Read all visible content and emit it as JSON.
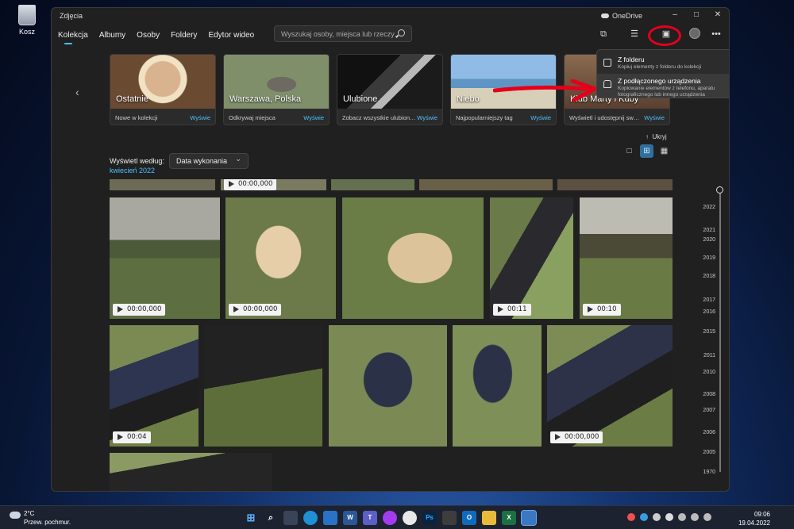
{
  "desktop": {
    "recycle_bin_label": "Kosz"
  },
  "window": {
    "title": "Zdjęcia",
    "onedrive_label": "OneDrive",
    "controls": {
      "minimize": "–",
      "maximize": "□",
      "close": "✕"
    }
  },
  "nav": {
    "tabs": [
      {
        "label": "Kolekcja",
        "active": true
      },
      {
        "label": "Albumy"
      },
      {
        "label": "Osoby"
      },
      {
        "label": "Foldery"
      },
      {
        "label": "Edytor wideo"
      }
    ],
    "search_placeholder": "Wyszukaj osoby, miejsca lub rzeczy…"
  },
  "toolbar": {
    "icons": [
      "slideshow-icon",
      "select-icon",
      "import-icon",
      "account-icon",
      "more-icon"
    ],
    "more_label": "•••"
  },
  "hero": {
    "cards": [
      {
        "title": "Ostatnie",
        "caption": "Nowe w kolekcji",
        "link": "Wyświe"
      },
      {
        "title": "Warszawa, Polska",
        "caption": "Odkrywaj miejsca",
        "link": "Wyświe"
      },
      {
        "title": "Ulubione",
        "caption": "Zobacz wszystkie ulubion…",
        "link": "Wyświe"
      },
      {
        "title": "Niebo",
        "caption": "Najpopularniejszy tag",
        "link": "Wyświe"
      },
      {
        "title": "Klub Marty i Kuby",
        "caption": "Wyświetl i udostępnij sw…",
        "link": "Wyświe"
      }
    ]
  },
  "import_menu": {
    "items": [
      {
        "title": "Z folderu",
        "desc": "Kopiuj elementy z folderu do kolekcji"
      },
      {
        "title": "Z podłączonego urządzenia",
        "desc": "Kopiowanie elementów z telefonu, aparatu fotograficznego lub innego urządzenia"
      }
    ]
  },
  "controls": {
    "view_by_label": "Wyświetl według:",
    "view_by_value": "Data wykonania",
    "hide_label": "Ukryj"
  },
  "month_label": "kwiecień 2022",
  "photos": {
    "top_strip_badge": "00:00,000",
    "row1": [
      "00:00,000",
      "00:00,000",
      "",
      "00:11",
      "00:10"
    ],
    "row2": [
      "00:04",
      "",
      "",
      "",
      "00:00,000"
    ]
  },
  "timeline": {
    "years": [
      "2022",
      "2021",
      "2020",
      "2019",
      "2018",
      "2017",
      "2016",
      "2015",
      "2011",
      "2010",
      "2008",
      "2007",
      "2006",
      "2005",
      "1970"
    ]
  },
  "taskbar": {
    "weather_temp": "2°C",
    "weather_desc": "Przew. pochmur.",
    "time": "09:06",
    "date": "19.04.2022",
    "apps": [
      "windows-icon",
      "search-icon",
      "taskview-icon",
      "edge-icon",
      "mail-icon",
      "word-icon",
      "teams-icon",
      "messenger-icon",
      "slack-icon",
      "photoshop-icon",
      "phone-link-icon",
      "outlook-icon",
      "explorer-icon",
      "excel-icon",
      "photos-icon"
    ],
    "app_labels": {
      "word": "W",
      "teams": "T",
      "ps": "Ps",
      "outlook": "O",
      "excel": "X"
    }
  },
  "colors": {
    "accent": "#4cc2ff",
    "annotation_red": "#e4001b"
  }
}
